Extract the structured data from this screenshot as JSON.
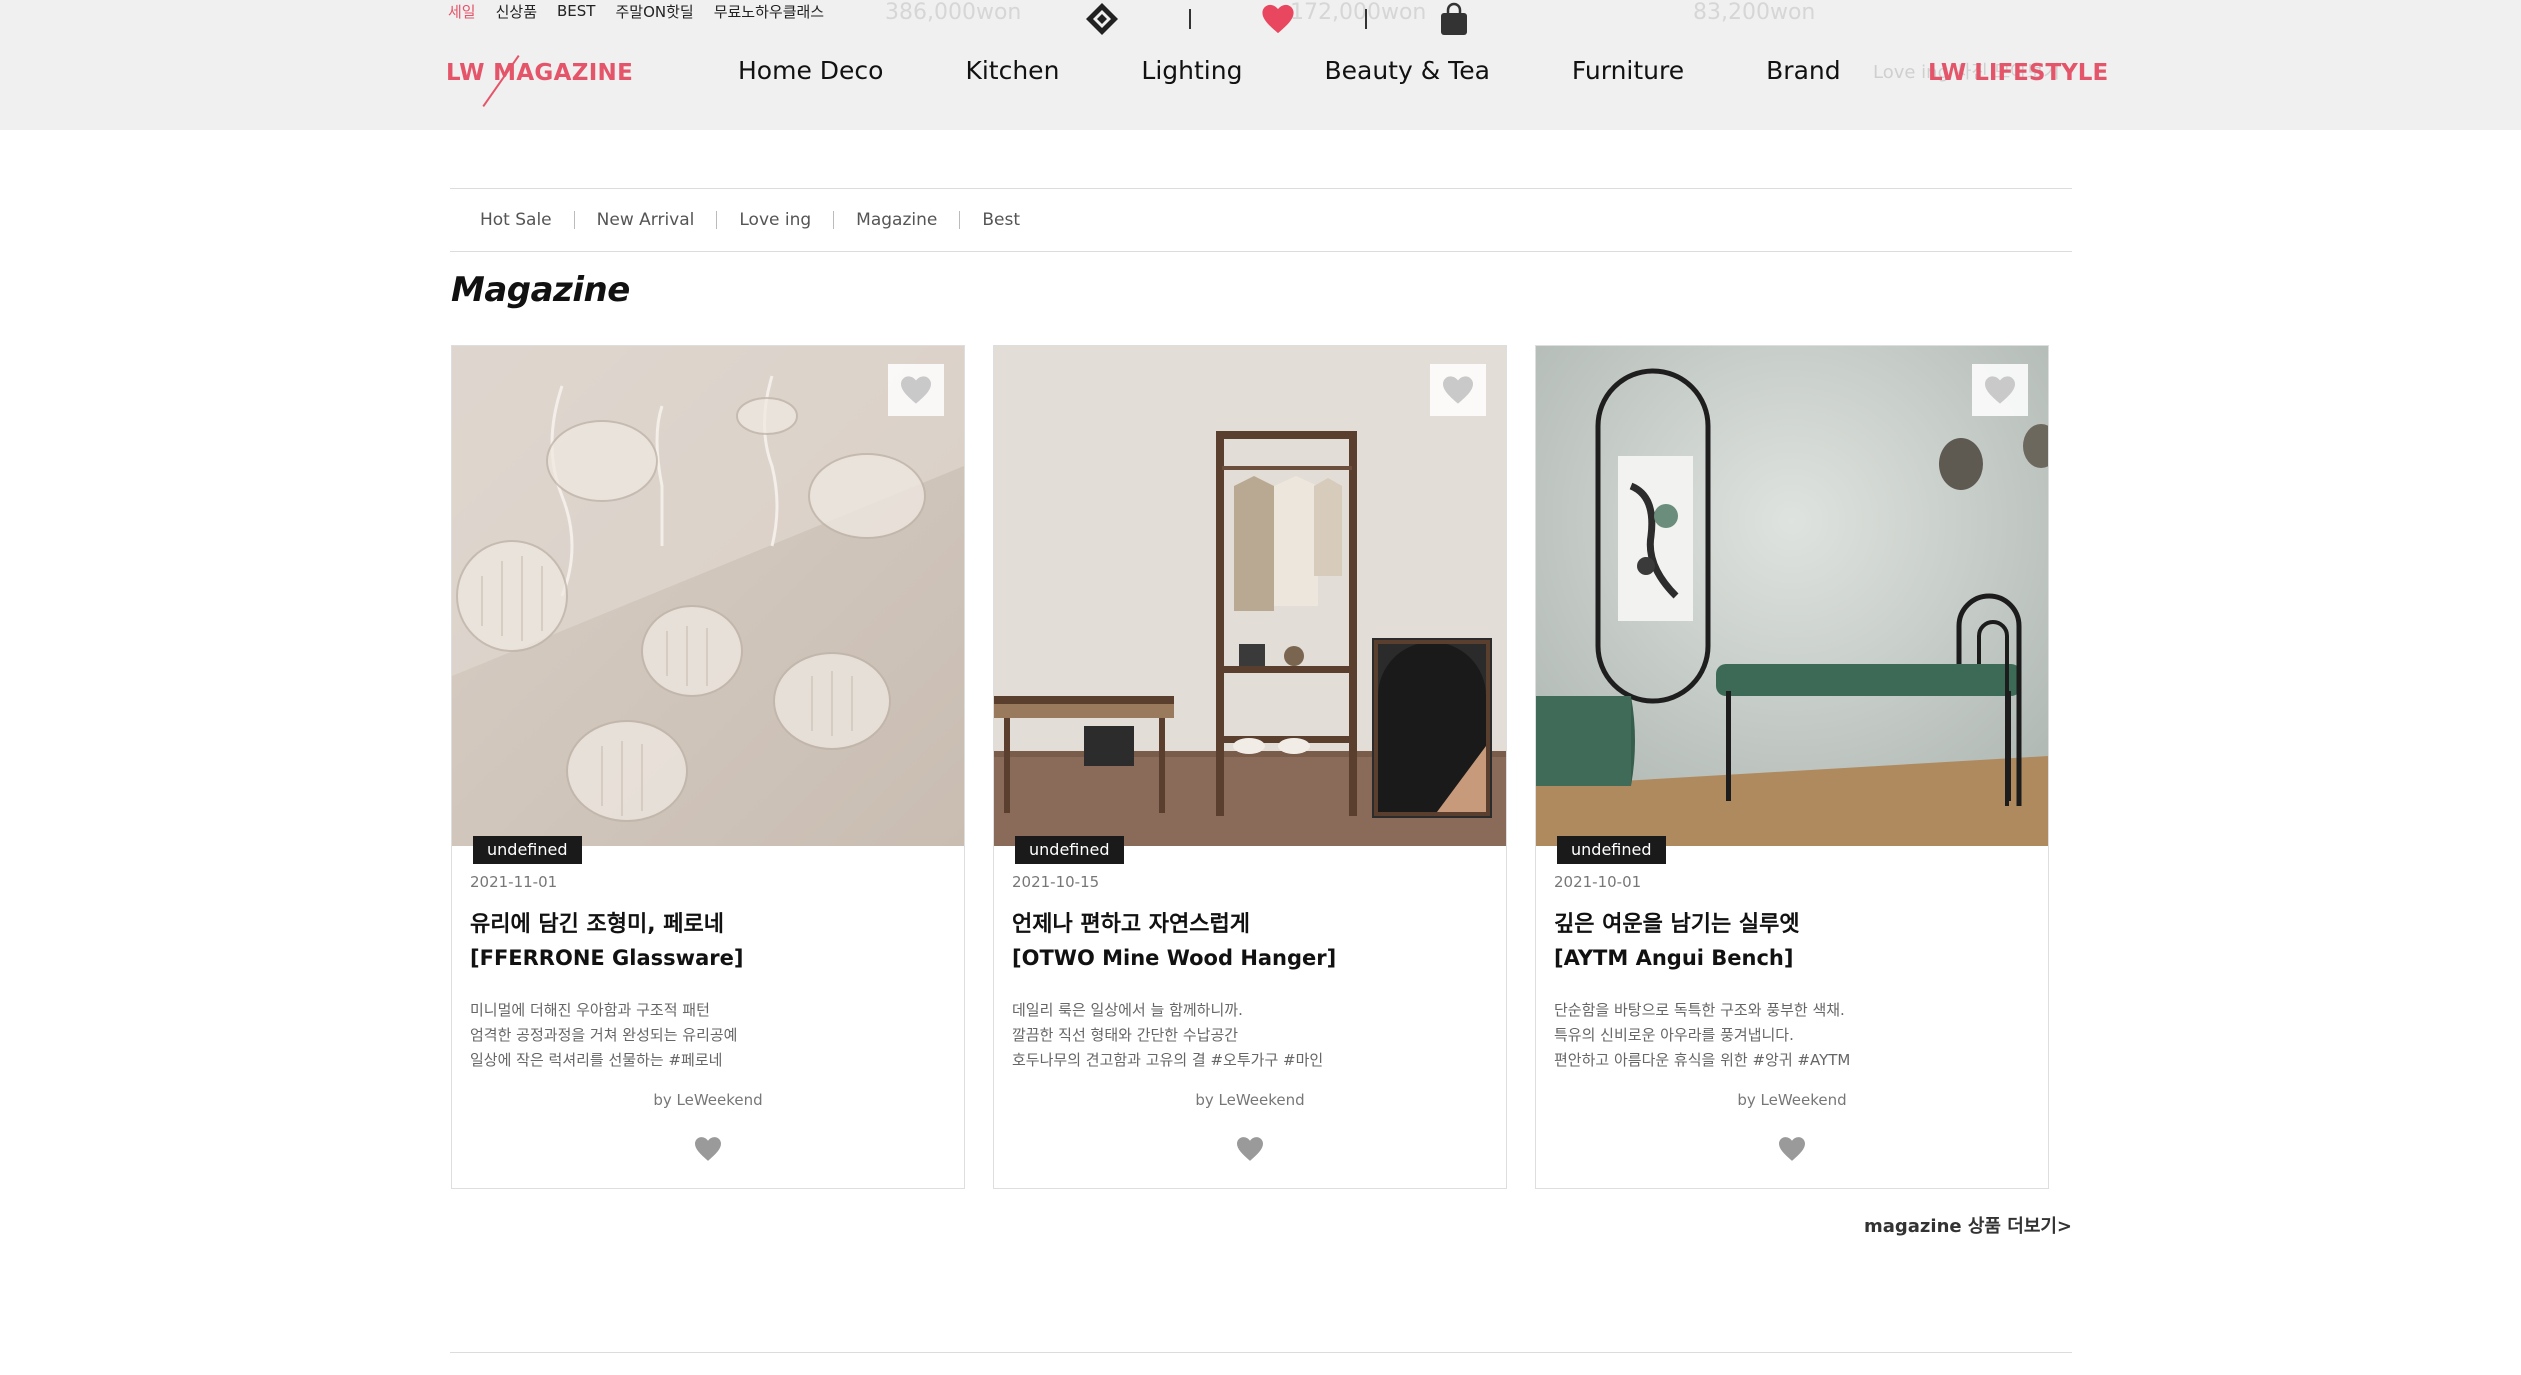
{
  "header": {
    "util_links": [
      "세일",
      "신상품",
      "BEST",
      "주말ON핫딜",
      "무료노하우클래스"
    ],
    "ghost_prices": [
      "386,000won",
      "172,000won",
      "83,200won"
    ],
    "logo_left": "LW MAGAZINE",
    "logo_right": "LW LIFESTYLE",
    "love_ghost": "Love ing 사진 모아보기",
    "nav": [
      "Home Deco",
      "Kitchen",
      "Lighting",
      "Beauty & Tea",
      "Furniture",
      "Brand"
    ],
    "icons": [
      "diamond-logo-icon",
      "heart-icon",
      "shopping-bag-icon"
    ]
  },
  "subnav": [
    "Hot Sale",
    "New Arrival",
    "Love ing",
    "Magazine",
    "Best"
  ],
  "section_title": "Magazine",
  "cards": [
    {
      "tag": "undefined",
      "date": "2021-11-01",
      "title1": "유리에 담긴 조형미, 페로네",
      "title2": "[FFERRONE Glassware]",
      "desc": [
        "미니멀에 더해진 우아함과 구조적 패턴",
        "엄격한 공정과정을 거쳐 완성되는 유리공예",
        "일상에 작은 럭셔리를 선물하는 #페로네"
      ],
      "by": "by LeWeekend"
    },
    {
      "tag": "undefined",
      "date": "2021-10-15",
      "title1": "언제나 편하고 자연스럽게",
      "title2": "[OTWO Mine Wood Hanger]",
      "desc": [
        "데일리 룩은 일상에서 늘 함께하니까.",
        "깔끔한 직선 형태와 간단한 수납공간",
        "호두나무의 견고함과 고유의 결 #오투가구 #마인"
      ],
      "by": "by LeWeekend"
    },
    {
      "tag": "undefined",
      "date": "2021-10-01",
      "title1": "깊은 여운을 남기는 실루엣",
      "title2": "[AYTM Angui Bench]",
      "desc": [
        "단순함을 바탕으로 독특한 구조와 풍부한 색채.",
        "특유의 신비로운 아우라를 풍겨냅니다.",
        "편안하고 아름다운 휴식을 위한 #앙귀 #AYTM"
      ],
      "by": "by LeWeekend"
    }
  ],
  "more_link": "magazine 상품 더보기>",
  "colors": {
    "brand": "#e5556a",
    "header_bg": "#f0f0f0",
    "tag_bg": "#1a1a1a"
  }
}
